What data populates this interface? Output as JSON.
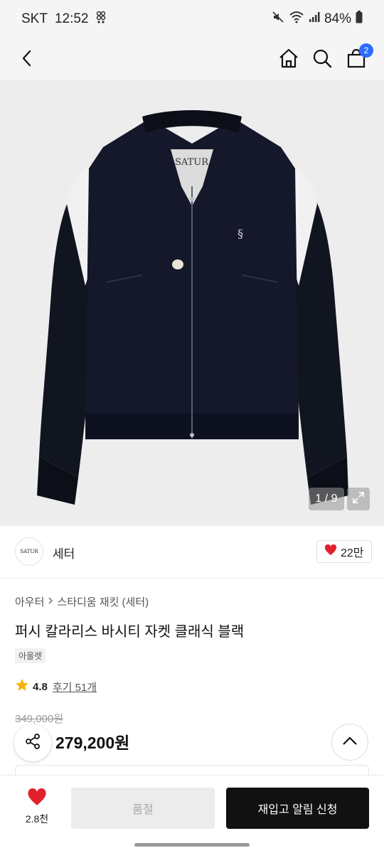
{
  "status_bar": {
    "carrier": "SKT",
    "time": "12:52",
    "battery": "84%"
  },
  "hero": {
    "counter": "1 / 9",
    "background": "#ededee"
  },
  "brand": {
    "logo_text": "SATUR",
    "name": "세터",
    "like_count": "22만"
  },
  "product": {
    "breadcrumb_category": "아우터",
    "breadcrumb_sub": "스타디움 재킷 (세터)",
    "title": "퍼시 칼라리스 바시티 자켓 클래식 블랙",
    "tag": "아울렛",
    "rating": "4.8",
    "reviews": "후기 51개",
    "original_price": "349,000원",
    "sale_price": "279,200원"
  },
  "nav": {
    "cart_count": "2"
  },
  "bottom_bar": {
    "wish_count": "2.8천",
    "soldout_label": "품절",
    "restock_label": "재입고 알림 신청"
  },
  "icons": [
    "back-arrow-icon",
    "home-icon",
    "search-icon",
    "shopping-bag-icon",
    "expand-icon",
    "heart-icon",
    "star-icon",
    "share-icon",
    "chevron-up-icon"
  ],
  "colors": {
    "accent_badge": "#2d6bff",
    "heart": "#e0202d",
    "star": "#f5b301",
    "primary_button": "#111111"
  }
}
